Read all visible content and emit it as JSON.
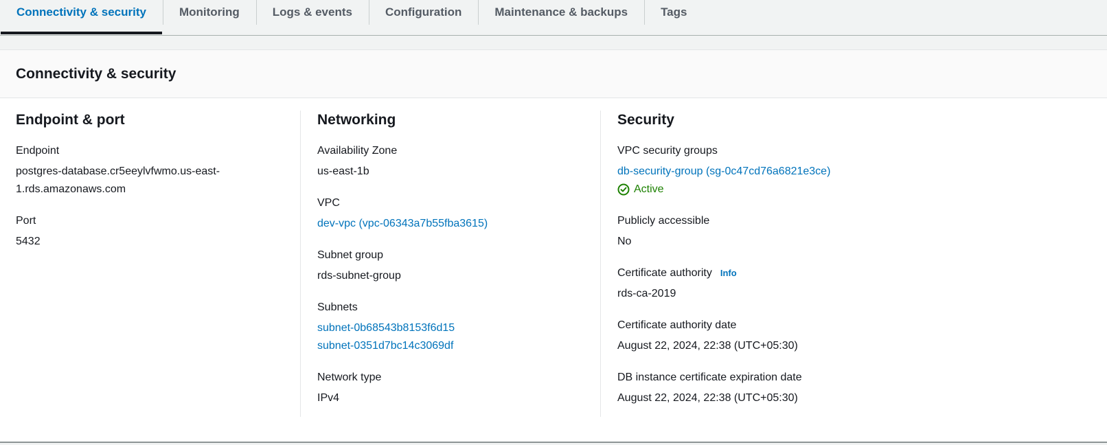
{
  "tabs": [
    {
      "label": "Connectivity & security",
      "active": true
    },
    {
      "label": "Monitoring",
      "active": false
    },
    {
      "label": "Logs & events",
      "active": false
    },
    {
      "label": "Configuration",
      "active": false
    },
    {
      "label": "Maintenance & backups",
      "active": false
    },
    {
      "label": "Tags",
      "active": false
    }
  ],
  "section": {
    "title": "Connectivity & security"
  },
  "endpoint_port": {
    "title": "Endpoint & port",
    "endpoint_label": "Endpoint",
    "endpoint_line1": "postgres-database.cr5eeylvfwmo.us-east-",
    "endpoint_line2": "1.rds.amazonaws.com",
    "port_label": "Port",
    "port_value": "5432"
  },
  "networking": {
    "title": "Networking",
    "az_label": "Availability Zone",
    "az_value": "us-east-1b",
    "vpc_label": "VPC",
    "vpc_value": "dev-vpc (vpc-06343a7b55fba3615)",
    "subnet_group_label": "Subnet group",
    "subnet_group_value": "rds-subnet-group",
    "subnets_label": "Subnets",
    "subnets": [
      "subnet-0b68543b8153f6d15",
      "subnet-0351d7bc14c3069df"
    ],
    "network_type_label": "Network type",
    "network_type_value": "IPv4"
  },
  "security": {
    "title": "Security",
    "sg_label": "VPC security groups",
    "sg_value": "db-security-group (sg-0c47cd76a6821e3ce)",
    "sg_status": "Active",
    "sg_status_icon": "check-circle-icon",
    "public_label": "Publicly accessible",
    "public_value": "No",
    "ca_label": "Certificate authority",
    "ca_info": "Info",
    "ca_value": "rds-ca-2019",
    "ca_date_label": "Certificate authority date",
    "ca_date_value": "August 22, 2024, 22:38 (UTC+05:30)",
    "cert_exp_label": "DB instance certificate expiration date",
    "cert_exp_value": "August 22, 2024, 22:38 (UTC+05:30)"
  },
  "colors": {
    "link": "#0073bb",
    "success": "#1d8102",
    "text": "#16191f",
    "tab_inactive": "#545b64"
  }
}
